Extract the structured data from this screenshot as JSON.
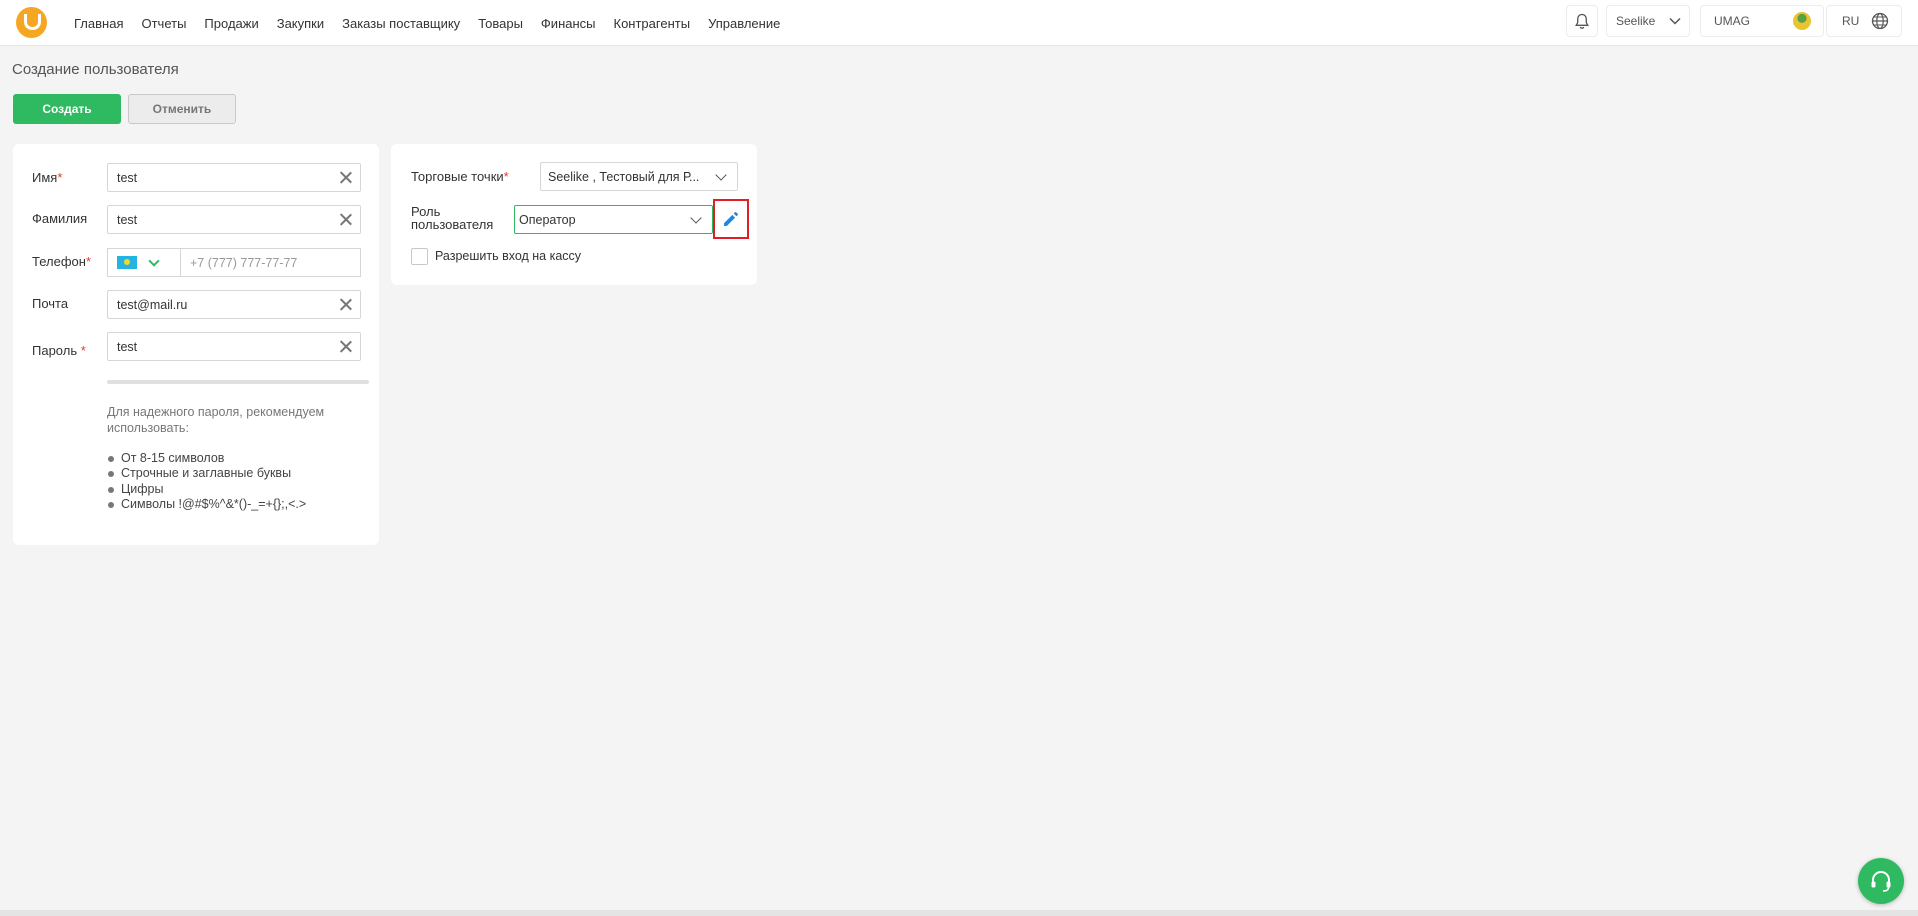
{
  "header": {
    "nav": [
      "Главная",
      "Отчеты",
      "Продажи",
      "Закупки",
      "Заказы поставщику",
      "Товары",
      "Финансы",
      "Контрагенты",
      "Управление"
    ],
    "org": "Seelike",
    "user": "UMAG",
    "lang": "RU"
  },
  "page": {
    "title": "Создание пользователя",
    "create_label": "Создать",
    "cancel_label": "Отменить"
  },
  "form": {
    "first_name": {
      "label": "Имя",
      "value": "test"
    },
    "last_name": {
      "label": "Фамилия",
      "value": "test"
    },
    "phone": {
      "label": "Телефон",
      "placeholder": "+7 (777) 777-77-77"
    },
    "email": {
      "label": "Почта",
      "value": "test@mail.ru"
    },
    "password": {
      "label": "Пароль",
      "value": "test"
    },
    "required_mark": "*",
    "password_hint": "Для надежного пароля, рекомендуем использовать:",
    "password_rules": [
      "От 8-15 символов",
      "Строчные и заглавные буквы",
      "Цифры",
      "Символы !@#$%^&*()-_=+{};,<.>"
    ]
  },
  "settings": {
    "stores_label": "Торговые точки",
    "stores_value": "Seelike , Тестовый для Р...",
    "role_label_1": "Роль",
    "role_label_2": "пользователя",
    "role_value": "Оператор",
    "cash_access_label": "Разрешить вход на кассу"
  },
  "colors": {
    "accent_green": "#2fba62",
    "logo_orange": "#f5a623",
    "required_red": "#e53935",
    "highlight_red": "#e11d25",
    "edit_blue": "#1e88e5"
  }
}
